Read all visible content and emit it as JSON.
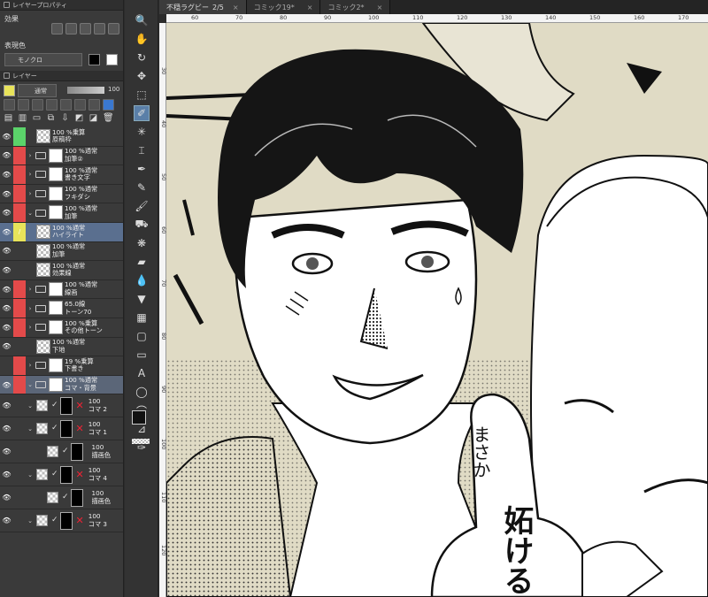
{
  "top_panel": {
    "title": "レイヤープロパティ"
  },
  "effect": {
    "label": "効果",
    "display_color_label": "表現色",
    "display_color_value": "モノクロ"
  },
  "layer_panel": {
    "title": "レイヤー",
    "blend_mode": "通常",
    "opacity": "100"
  },
  "layers": [
    {
      "eye": true,
      "color": "green",
      "lock": "",
      "expand": "",
      "folder": false,
      "name1": "100 %乗算",
      "name2": "原稿枠",
      "selected": false
    },
    {
      "eye": true,
      "color": "red",
      "lock": "",
      "expand": ">",
      "folder": true,
      "name1": "100 %通常",
      "name2": "加筆②",
      "selected": false
    },
    {
      "eye": true,
      "color": "red",
      "lock": "",
      "expand": ">",
      "folder": true,
      "name1": "100 %通常",
      "name2": "書き文字",
      "selected": false
    },
    {
      "eye": true,
      "color": "red",
      "lock": "",
      "expand": ">",
      "folder": true,
      "name1": "100 %通常",
      "name2": "フキダシ",
      "selected": false
    },
    {
      "eye": true,
      "color": "red",
      "lock": "",
      "expand": "v",
      "folder": true,
      "name1": "100 %通常",
      "name2": "加筆",
      "selected": false
    },
    {
      "eye": true,
      "color": "yellow",
      "lock": "/",
      "expand": "",
      "folder": false,
      "name1": "100 %通常",
      "name2": "ハイライト",
      "selected": true
    },
    {
      "eye": true,
      "color": "none",
      "lock": "",
      "expand": "",
      "folder": false,
      "name1": "100 %通常",
      "name2": "加筆",
      "selected": false
    },
    {
      "eye": true,
      "color": "none",
      "lock": "",
      "expand": "",
      "folder": false,
      "name1": "100 %通常",
      "name2": "効果線",
      "selected": false
    },
    {
      "eye": true,
      "color": "red",
      "lock": "",
      "expand": ">",
      "folder": true,
      "name1": "100 %通常",
      "name2": "線画",
      "selected": false
    },
    {
      "eye": true,
      "color": "red",
      "lock": "",
      "expand": ">",
      "folder": true,
      "name1": "65.0線",
      "name2": "トーン70",
      "selected": false
    },
    {
      "eye": true,
      "color": "red",
      "lock": "",
      "expand": ">",
      "folder": true,
      "name1": "100 %乗算",
      "name2": "その他トーン",
      "selected": false
    },
    {
      "eye": true,
      "color": "none",
      "lock": "",
      "expand": "",
      "folder": false,
      "name1": "100 %通常",
      "name2": "下地",
      "selected": false
    },
    {
      "eye": false,
      "color": "red",
      "lock": "",
      "expand": ">",
      "folder": true,
      "name1": "19 %乗算",
      "name2": "下書き",
      "selected": false
    },
    {
      "eye": true,
      "color": "red",
      "lock": "",
      "expand": "v",
      "folder": true,
      "name1": "100 %通常",
      "name2": "コマ・背景",
      "selected": true
    }
  ],
  "koma_rows": [
    {
      "pct": "100",
      "name": "コマ 2"
    },
    {
      "pct": "100",
      "name": "コマ 1"
    },
    {
      "pct": "100",
      "name": "描画色"
    },
    {
      "pct": "100",
      "name": "コマ 4"
    },
    {
      "pct": "100",
      "name": "描画色"
    },
    {
      "pct": "100",
      "name": "コマ 3"
    }
  ],
  "tabs": [
    {
      "label": "不穏ラグビー",
      "page": "2/5",
      "active": true
    },
    {
      "label": "コミック19*",
      "page": "",
      "active": false
    },
    {
      "label": "コミック2*",
      "page": "",
      "active": false
    }
  ],
  "ruler_h": [
    "60",
    "70",
    "80",
    "90",
    "100",
    "110",
    "120",
    "130",
    "140",
    "150",
    "160",
    "170"
  ],
  "ruler_v": [
    "30",
    "40",
    "50",
    "60",
    "70",
    "80",
    "90",
    "100",
    "110",
    "120"
  ],
  "speech_bubble": {
    "line1": "まさか",
    "line2": "妬ける"
  },
  "colors": {
    "accent": "#5a7fa8",
    "tone": "#e0dbc5",
    "layer_red": "#e34a4a",
    "layer_green": "#5bd36a",
    "layer_yellow": "#e8e35a"
  }
}
